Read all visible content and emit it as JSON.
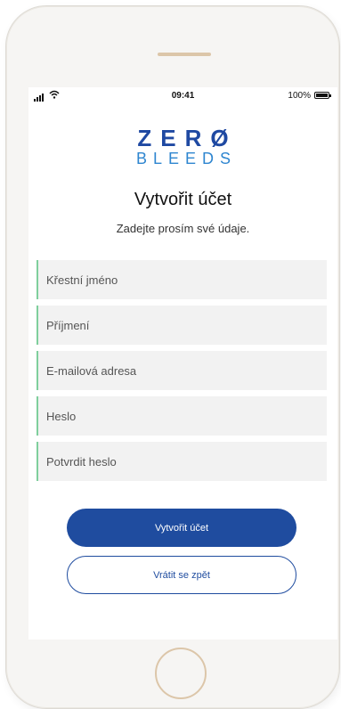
{
  "status_bar": {
    "time": "09:41",
    "battery_percent": "100%"
  },
  "logo": {
    "top_text": "ZERØ",
    "bottom_text": "BLEEDS"
  },
  "header": {
    "title": "Vytvořit účet",
    "subtitle": "Zadejte prosím své údaje."
  },
  "form": {
    "first_name_placeholder": "Křestní jméno",
    "last_name_placeholder": "Příjmení",
    "email_placeholder": "E-mailová adresa",
    "password_placeholder": "Heslo",
    "confirm_password_placeholder": "Potvrdit heslo"
  },
  "buttons": {
    "create_account_label": "Vytvořit účet",
    "go_back_label": "Vrátit se zpět"
  },
  "colors": {
    "primary": "#1f4c9f",
    "logo_secondary": "#2f86d0",
    "field_accent": "#7fcf9d",
    "field_background": "#f2f2f2",
    "device_gold": "#dcc6a9"
  },
  "icons": [
    "signal-icon",
    "wifi-icon",
    "battery-icon"
  ]
}
